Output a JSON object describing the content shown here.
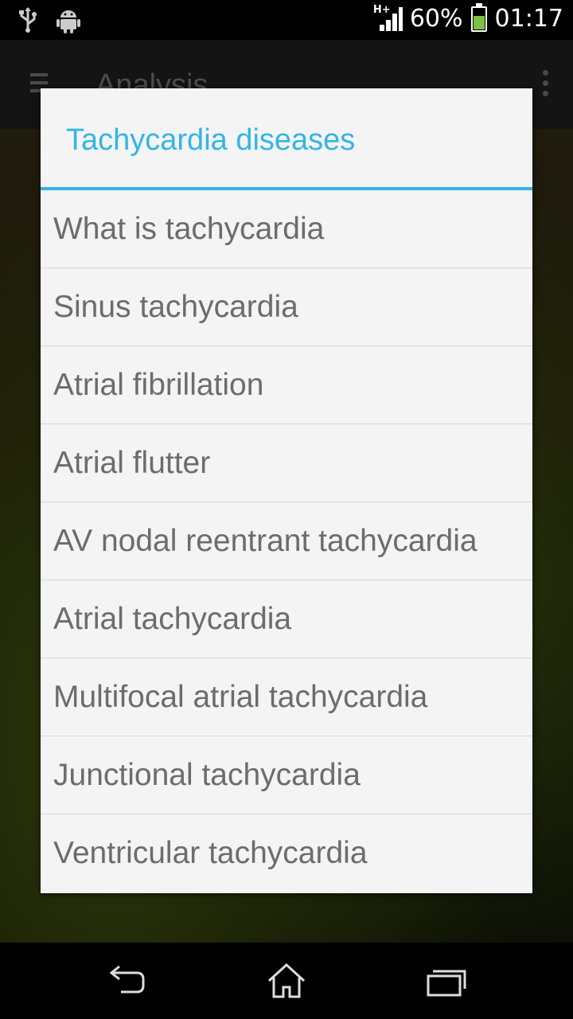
{
  "status_bar": {
    "network": "H+",
    "battery_percent": "60%",
    "time": "01:17",
    "battery_level": 0.6,
    "left_icons": [
      "usb-icon",
      "android-icon"
    ]
  },
  "action_bar": {
    "title": "Analysis"
  },
  "dialog": {
    "title": "Tachycardia diseases",
    "accent_color": "#33b5e5",
    "items": [
      {
        "label": "What is tachycardia"
      },
      {
        "label": "Sinus tachycardia"
      },
      {
        "label": "Atrial fibrillation"
      },
      {
        "label": "Atrial flutter"
      },
      {
        "label": "AV nodal reentrant tachycardia"
      },
      {
        "label": "Atrial tachycardia"
      },
      {
        "label": "Multifocal atrial tachycardia"
      },
      {
        "label": "Junctional tachycardia"
      },
      {
        "label": "Ventricular tachycardia"
      }
    ]
  },
  "nav_bar": {
    "buttons": [
      "back-icon",
      "home-icon",
      "recent-apps-icon"
    ]
  }
}
